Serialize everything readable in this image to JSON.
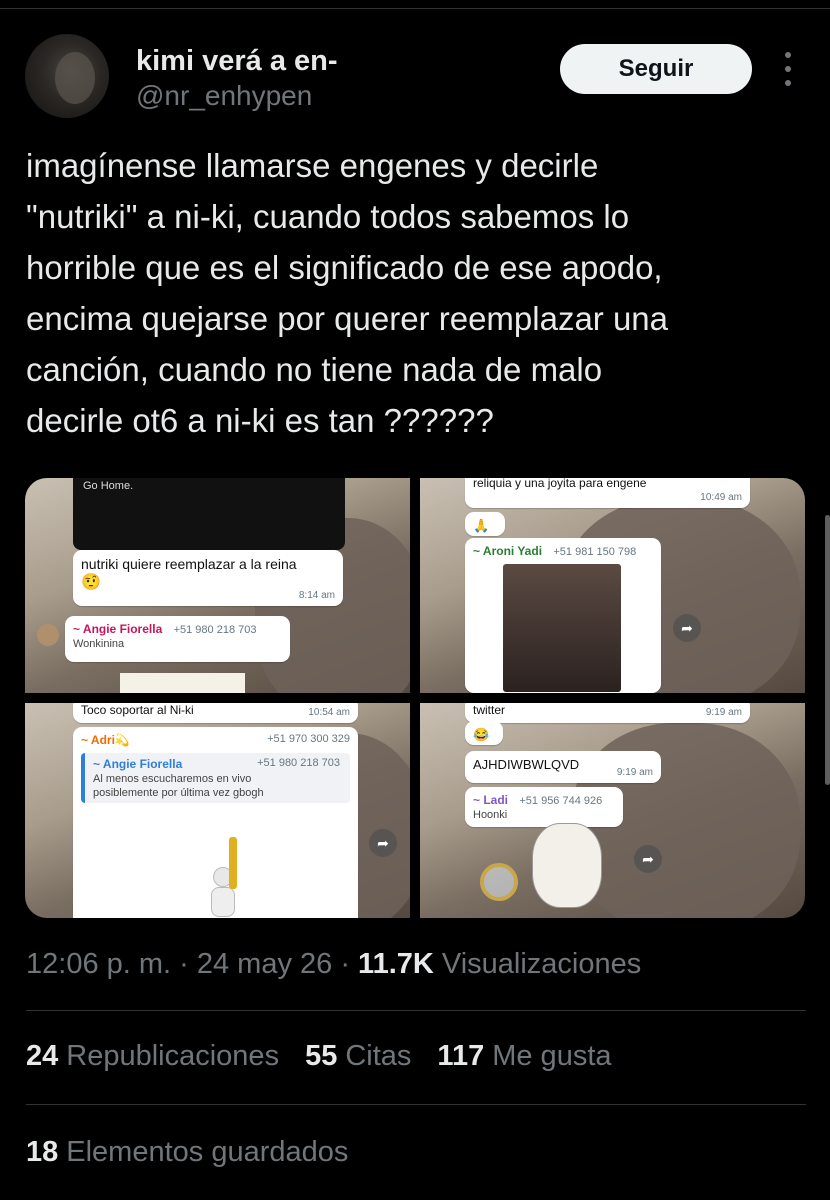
{
  "tweet": {
    "author_name": "kimi verá a en-",
    "author_handle": "@nr_enhypen",
    "follow_label": "Seguir",
    "text_lines": [
      "imagínense llamarse engenes y decirle",
      "\"nutriki\" a ni-ki, cuando todos sabemos lo",
      "horrible que es el significado de ese apodo,",
      "encima quejarse por querer reemplazar una",
      "canción, cuando no tiene nada de malo",
      "decirle ot6 a ni-ki es tan ??????"
    ]
  },
  "media": {
    "t1": {
      "top_text": "Go Home.",
      "msg": "nutriki quiere reemplazar a la reina",
      "msg_emoji": "🤨",
      "msg_time": "8:14 am",
      "sender": "~ Angie Fiorella",
      "phone": "+51 980 218 703",
      "sub": "Wonkinina"
    },
    "t2": {
      "top_text": "reliquia y una joyita para engene",
      "top_time": "10:49 am",
      "sender": "~ Aroni Yadi",
      "phone": "+51 981 150 798"
    },
    "t3": {
      "top_text": "Toco soportar al Ni-ki",
      "top_time": "10:54 am",
      "sender": "~ Adri💫",
      "phone": "+51 970 300 329",
      "quote_sender": "~ Angie Fiorella",
      "quote_phone": "+51 980 218 703",
      "quote_line1": "Al menos escucharemos en vivo",
      "quote_line2": "posiblemente por última vez gbogh"
    },
    "t4": {
      "top_text": "twitter",
      "top_time": "9:19 am",
      "emoji": "😂",
      "msg": "AJHDIWBWLQVD",
      "msg_time": "9:19 am",
      "sender": "~ Ladi",
      "phone": "+51 956 744 926",
      "sub": "Hoonki"
    }
  },
  "meta": {
    "time_date": "12:06 p. m. · 24 may 26 · ",
    "views_count": "11.7K",
    "views_label": " Visualizaciones"
  },
  "stats": {
    "reposts_count": "24",
    "reposts_label": "Republicaciones",
    "quotes_count": "55",
    "quotes_label": "Citas",
    "likes_count": "117",
    "likes_label": "Me gusta",
    "bookmarks_count": "18",
    "bookmarks_label": "Elementos guardados"
  },
  "colors": {
    "background": "#000000",
    "text": "#e7e9ea",
    "secondary": "#71767b",
    "button": "#eff3f4"
  }
}
